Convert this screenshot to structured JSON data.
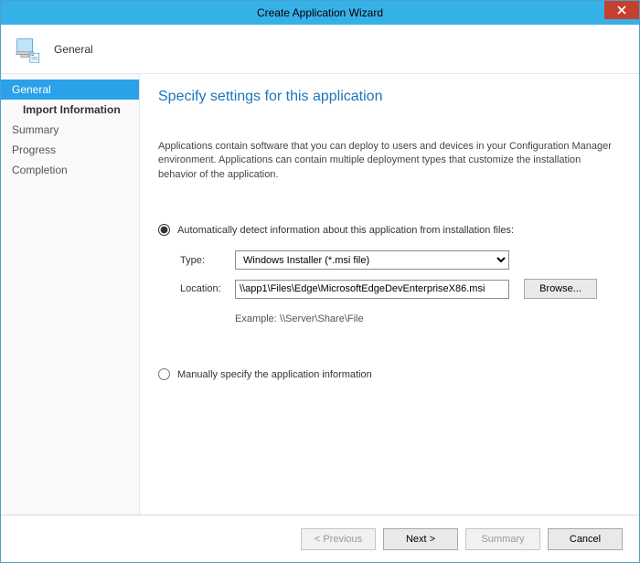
{
  "window": {
    "title": "Create Application Wizard"
  },
  "banner": {
    "title": "General"
  },
  "sidebar": {
    "items": [
      {
        "label": "General",
        "active": true
      },
      {
        "label": "Import Information",
        "sub": true
      },
      {
        "label": "Summary"
      },
      {
        "label": "Progress"
      },
      {
        "label": "Completion"
      }
    ]
  },
  "content": {
    "heading": "Specify settings for this application",
    "description": "Applications contain software that you can deploy to users and devices in your Configuration Manager environment. Applications can contain multiple deployment types that customize the installation behavior of the application.",
    "radio_auto_label": "Automatically detect information about this application from installation files:",
    "radio_manual_label": "Manually specify the application information",
    "type_label": "Type:",
    "type_value": "Windows Installer (*.msi file)",
    "location_label": "Location:",
    "location_value": "\\\\app1\\Files\\Edge\\MicrosoftEdgeDevEnterpriseX86.msi",
    "browse_label": "Browse...",
    "example_label": "Example: \\\\Server\\Share\\File"
  },
  "footer": {
    "previous": "< Previous",
    "next": "Next >",
    "summary": "Summary",
    "cancel": "Cancel"
  }
}
